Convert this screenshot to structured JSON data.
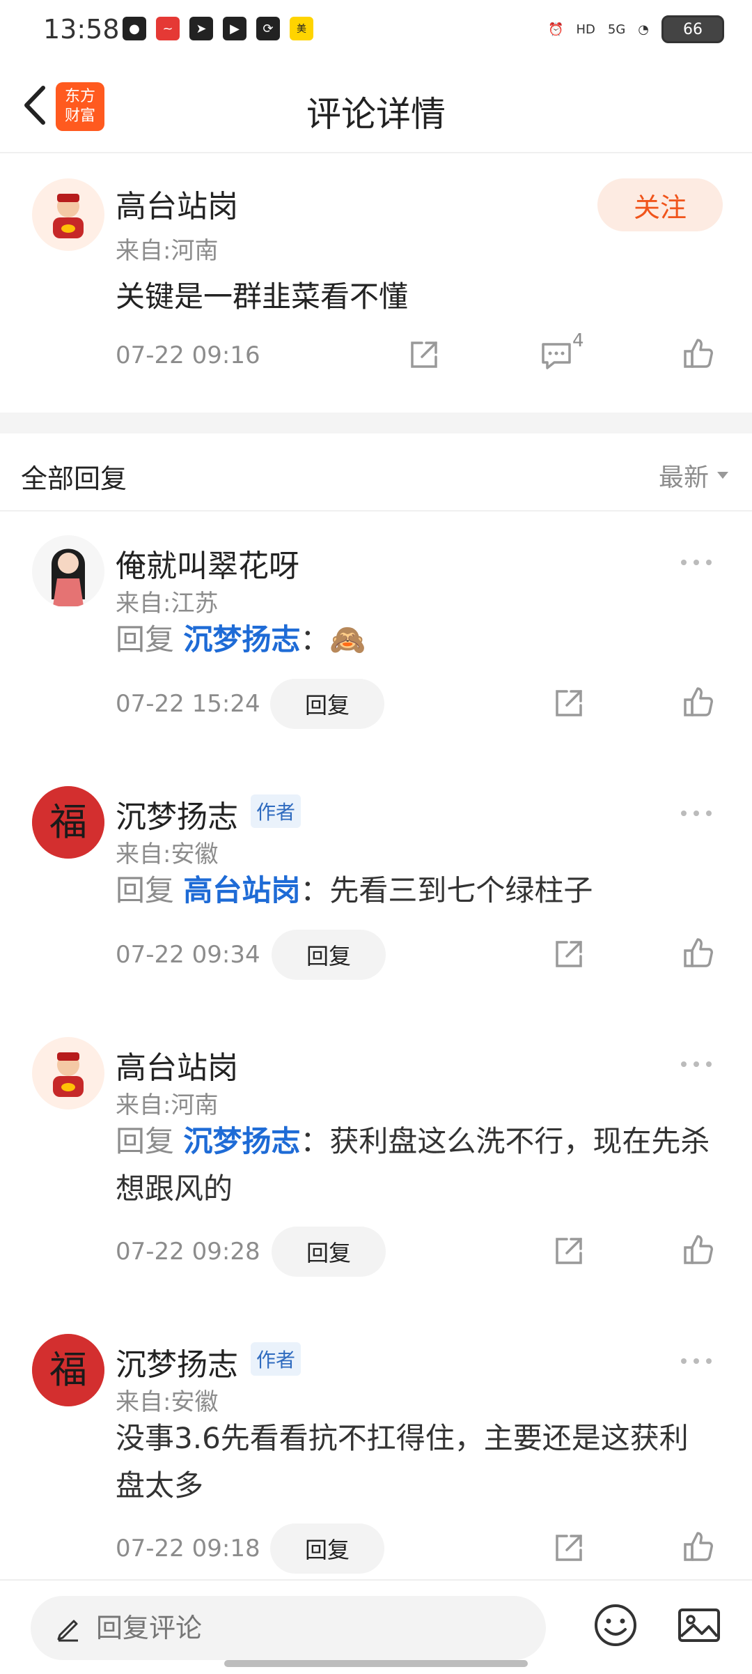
{
  "status": {
    "time": "13:58",
    "battery": "66",
    "network": "5G",
    "hd": "HD"
  },
  "nav": {
    "title": "评论详情",
    "logo_text": "东方\n财富"
  },
  "main_comment": {
    "user": "高台站岗",
    "location": "来自:河南",
    "content": "关键是一群韭菜看不懂",
    "time": "07-22 09:16",
    "follow_label": "关注",
    "comment_count": "4"
  },
  "section": {
    "title": "全部回复",
    "sort_label": "最新"
  },
  "replies": [
    {
      "user": "俺就叫翠花呀",
      "location": "来自:江苏",
      "prefix": "回复",
      "mention": "沉梦扬志",
      "text": "：🙈",
      "time": "07-22 15:24",
      "button": "回复",
      "is_author": false
    },
    {
      "user": "沉梦扬志",
      "badge": "作者",
      "location": "来自:安徽",
      "prefix": "回复",
      "mention": "高台站岗",
      "text": "：先看三到七个绿柱子",
      "time": "07-22 09:34",
      "button": "回复",
      "is_author": true
    },
    {
      "user": "高台站岗",
      "location": "来自:河南",
      "prefix": "回复",
      "mention": "沉梦扬志",
      "text": "：获利盘这么洗不行，现在先杀想跟风的",
      "time": "07-22 09:28",
      "button": "回复",
      "is_author": false
    },
    {
      "user": "沉梦扬志",
      "badge": "作者",
      "location": "来自:安徽",
      "text": "没事3.6先看看抗不扛得住，主要还是这获利盘太多",
      "time": "07-22 09:18",
      "button": "回复",
      "is_author": true
    }
  ],
  "bottom": {
    "input_placeholder": "回复评论"
  },
  "colors": {
    "accent": "#f0541b",
    "mention": "#1e6bd6",
    "muted": "#8c8c8c"
  }
}
